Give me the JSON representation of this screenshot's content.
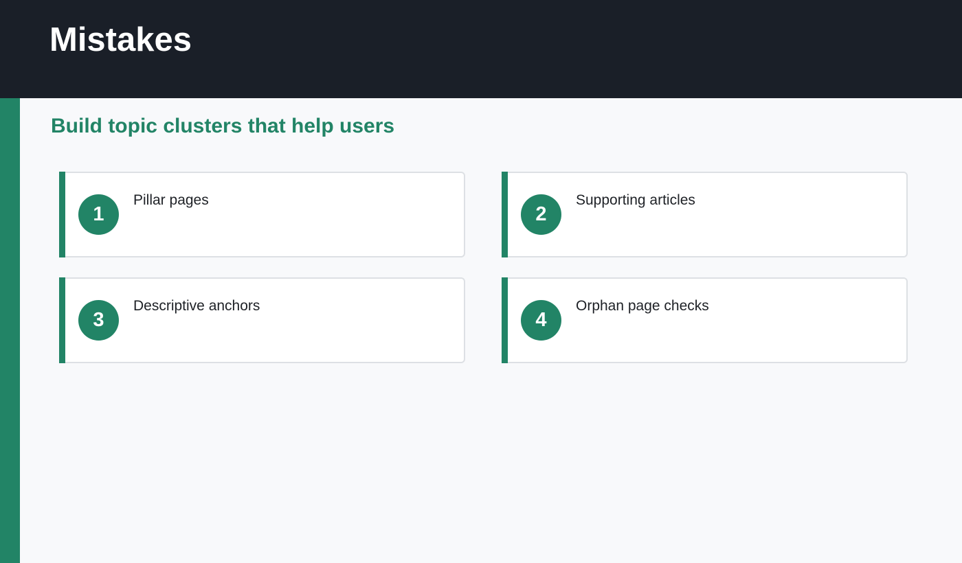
{
  "header": {
    "title": "Mistakes"
  },
  "section": {
    "subtitle": "Build topic clusters that help users"
  },
  "cards": [
    {
      "number": "1",
      "label": "Pillar pages"
    },
    {
      "number": "2",
      "label": "Supporting articles"
    },
    {
      "number": "3",
      "label": "Descriptive anchors"
    },
    {
      "number": "4",
      "label": "Orphan page checks"
    }
  ],
  "colors": {
    "header_bg": "#1a1f28",
    "accent": "#228466",
    "page_bg": "#f8f9fb",
    "card_bg": "#ffffff",
    "card_border": "#dde0e4",
    "text": "#1e2126"
  }
}
